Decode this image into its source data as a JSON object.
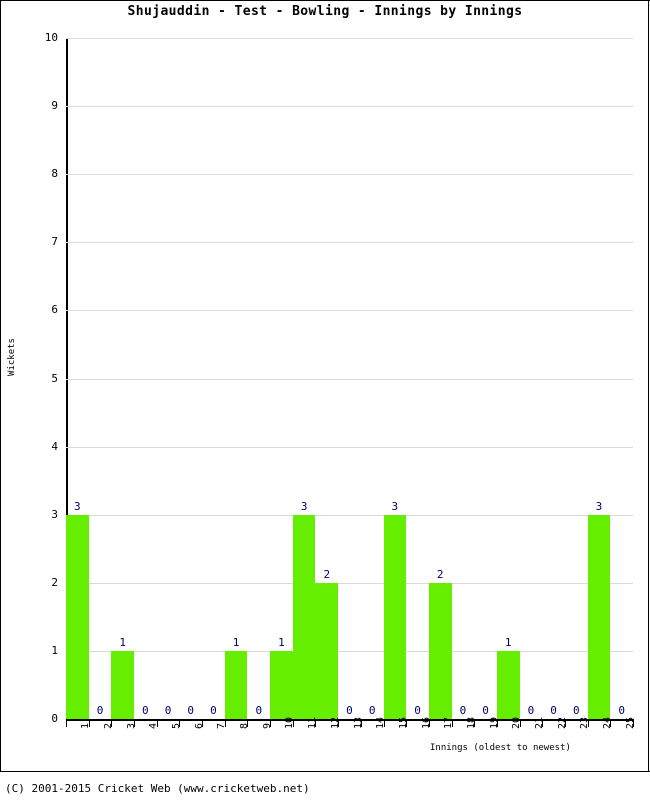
{
  "title": "Shujauddin - Test - Bowling - Innings by Innings",
  "footer": "(C) 2001-2015 Cricket Web (www.cricketweb.net)",
  "axes": {
    "ylabel": "Wickets",
    "xlabel": "Innings (oldest to newest)"
  },
  "colors": {
    "bar": "#66EE00",
    "value_label": "#000066",
    "grid": "#D9D9D9",
    "axis": "#000000",
    "background": "#FFFFFF"
  },
  "chart_data": {
    "type": "bar",
    "title": "Shujauddin - Test - Bowling - Innings by Innings",
    "xlabel": "Innings (oldest to newest)",
    "ylabel": "Wickets",
    "categories": [
      "1",
      "2",
      "3",
      "4",
      "5",
      "6",
      "7",
      "8",
      "9",
      "10",
      "11",
      "12",
      "13",
      "14",
      "15",
      "16",
      "17",
      "18",
      "19",
      "20",
      "21",
      "22",
      "23",
      "24",
      "25"
    ],
    "values": [
      3,
      0,
      1,
      0,
      0,
      0,
      0,
      1,
      0,
      1,
      3,
      2,
      0,
      0,
      3,
      0,
      2,
      0,
      0,
      1,
      0,
      0,
      0,
      3,
      0
    ],
    "ylim": [
      0,
      10
    ],
    "yticks": [
      0,
      1,
      2,
      3,
      4,
      5,
      6,
      7,
      8,
      9,
      10
    ],
    "grid": true,
    "legend": "none",
    "bar_color": "#66EE00",
    "data_labels": true
  }
}
